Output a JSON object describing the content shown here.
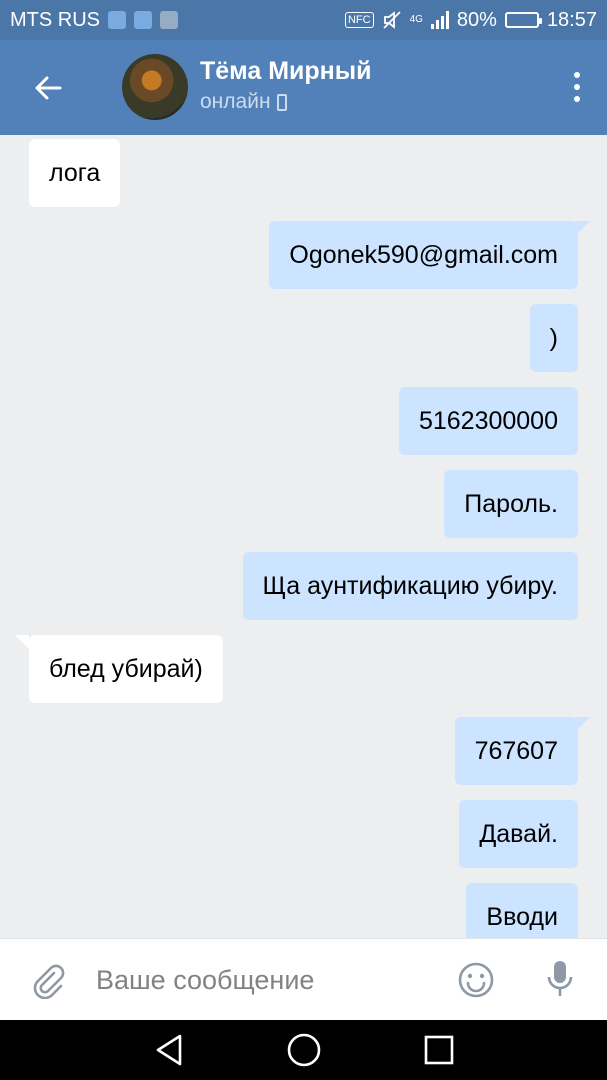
{
  "status_bar": {
    "carrier": "MTS RUS",
    "battery_percent": "80%",
    "battery_level": 0.8,
    "time": "18:57",
    "nfc_label": "NFC",
    "network_label": "4G"
  },
  "header": {
    "contact_name": "Тёма Мирный",
    "presence": "онлайн"
  },
  "messages": [
    {
      "direction": "in",
      "text": "лога"
    },
    {
      "direction": "out",
      "text": "Ogonek590@gmail.com"
    },
    {
      "direction": "out",
      "text": ")"
    },
    {
      "direction": "out",
      "text": "5162300000"
    },
    {
      "direction": "out",
      "text": "Пароль."
    },
    {
      "direction": "out",
      "text": "Ща аунтификацию убиру."
    },
    {
      "direction": "in",
      "text": "блед убирай)"
    },
    {
      "direction": "out",
      "text": "767607"
    },
    {
      "direction": "out",
      "text": "Давай."
    },
    {
      "direction": "out",
      "text": "Вводи"
    }
  ],
  "composer": {
    "placeholder": "Ваше сообщение"
  },
  "colors": {
    "header_bg": "#5181b8",
    "status_bg": "#4a76a8",
    "chat_bg": "#edeef0",
    "outgoing_bubble": "#cce4ff",
    "incoming_bubble": "#ffffff"
  },
  "icons": {
    "back": "arrow-left-icon",
    "menu": "more-vertical-icon",
    "attach": "paperclip-icon",
    "emoji": "smiley-icon",
    "mic": "microphone-icon",
    "nav_back": "triangle-back-icon",
    "nav_home": "circle-home-icon",
    "nav_recent": "square-recent-icon"
  }
}
